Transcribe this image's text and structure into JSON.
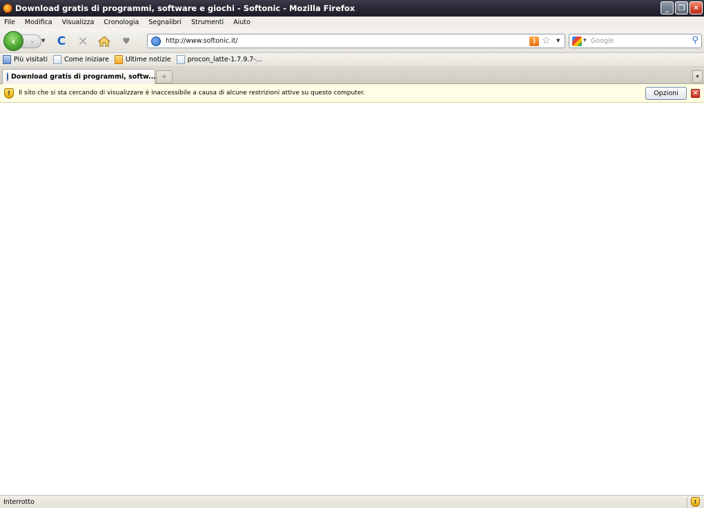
{
  "window": {
    "title": "Download gratis di programmi, software e giochi - Softonic - Mozilla Firefox",
    "minimize": "_",
    "restore": "❐",
    "close": "✕"
  },
  "menu": [
    {
      "label": "File"
    },
    {
      "label": "Modifica"
    },
    {
      "label": "Visualizza"
    },
    {
      "label": "Cronologia"
    },
    {
      "label": "Segnalibri"
    },
    {
      "label": "Strumenti"
    },
    {
      "label": "Aiuto"
    }
  ],
  "nav": {
    "back_glyph": "‹",
    "forward_glyph": "›",
    "dropdown_glyph": "▼",
    "reload_glyph": "C",
    "stop_glyph": "✕",
    "plugin_glyph": "♥",
    "url": "http://www.softonic.it/",
    "rss_glyph": ")",
    "star_glyph": "☆",
    "search_placeholder": "Google",
    "search_go_glyph": "⚲"
  },
  "bookmarks": [
    {
      "label": "Più visitati",
      "icon": "smart-bookmark-icon"
    },
    {
      "label": "Come iniziare",
      "icon": "page-icon"
    },
    {
      "label": "Ultime notizie",
      "icon": "feed-icon"
    },
    {
      "label": "procon_latte-1.7.9.7-...",
      "icon": "page-icon"
    }
  ],
  "tabs": {
    "active_label": "Download gratis di programmi, softw...",
    "new_tab_glyph": "+",
    "list_glyph": "▼"
  },
  "notification": {
    "message": "Il sito che si sta cercando di visualizzare è inaccessibile a causa di alcune restrizioni attive su questo computer.",
    "button_label": "Opzioni",
    "close_glyph": "✕",
    "icon_glyph": "!"
  },
  "status": {
    "text": "Interrotto",
    "shield_glyph": "!"
  },
  "colors": {
    "notification_bg": "#fffde4",
    "back_button": "#4ba832",
    "close_button": "#d2412a"
  }
}
